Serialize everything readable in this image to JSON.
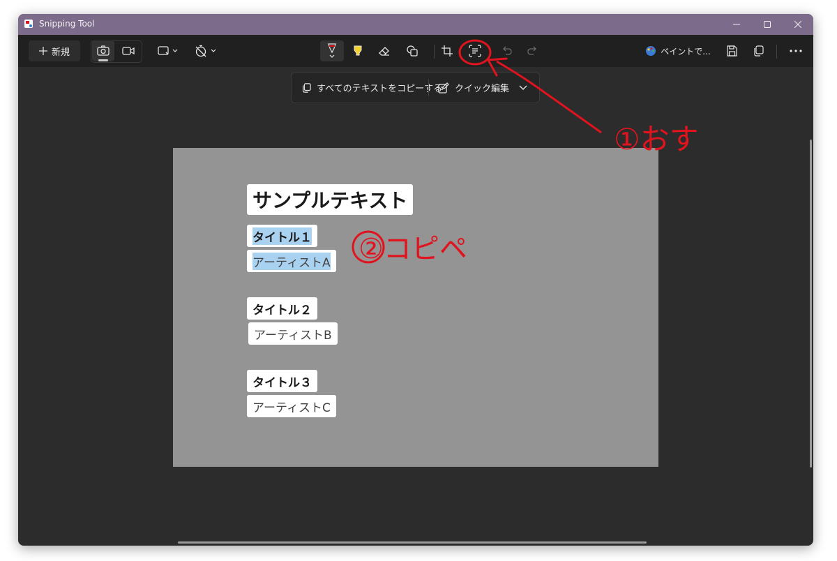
{
  "window": {
    "title": "Snipping Tool"
  },
  "toolbar": {
    "new_label": "新規",
    "paint_label": "ペイントで..."
  },
  "text_actions": {
    "copy_all_label": "すべてのテキストをコピーする",
    "quick_edit_label": "クイック編集"
  },
  "image": {
    "heading": "サンプルテキスト",
    "items": [
      {
        "title": "タイトル１",
        "artist": "アーティストA"
      },
      {
        "title": "タイトル２",
        "artist": "アーティストB"
      },
      {
        "title": "タイトル３",
        "artist": "アーティストC"
      }
    ]
  },
  "annotations": {
    "step1": "①おす",
    "step2": "②コピペ"
  },
  "colors": {
    "titlebar": "#7d6b8c",
    "annotation": "#e0141e",
    "selection": "#a9d1f0",
    "canvas": "#949494"
  }
}
